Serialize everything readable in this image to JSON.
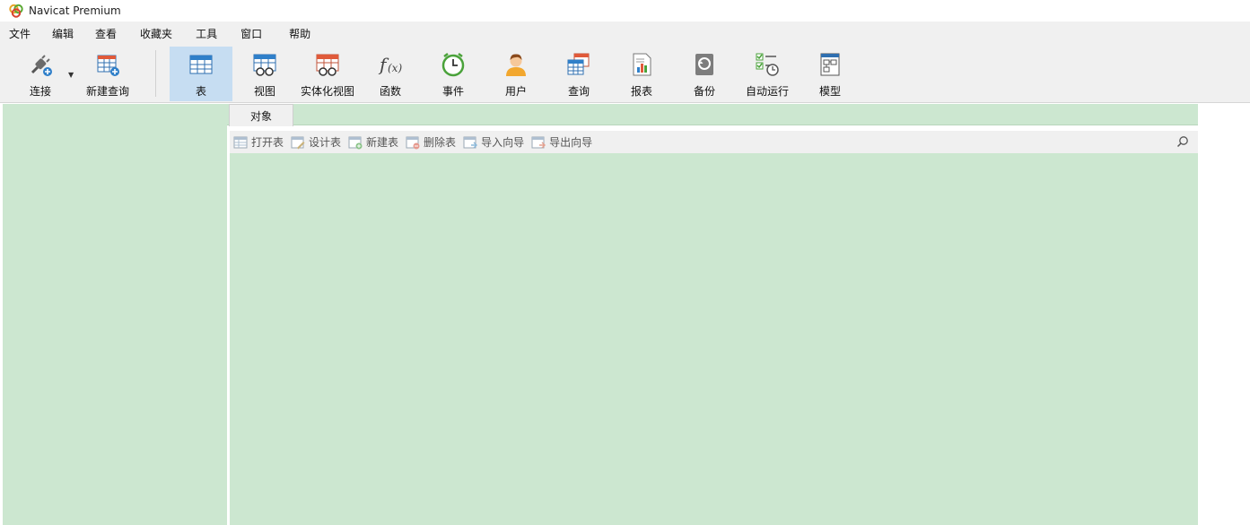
{
  "window": {
    "title": "Navicat Premium"
  },
  "menu": [
    "文件",
    "编辑",
    "查看",
    "收藏夹",
    "工具",
    "窗口",
    "帮助"
  ],
  "toolbar": {
    "connect": "连接",
    "new_query": "新建查询",
    "table": "表",
    "view": "视图",
    "materialized_view": "实体化视图",
    "function": "函数",
    "event": "事件",
    "user": "用户",
    "query": "查询",
    "report": "报表",
    "backup": "备份",
    "automation": "自动运行",
    "model": "模型"
  },
  "tabs": {
    "objects": "对象"
  },
  "object_toolbar": {
    "open_table": "打开表",
    "design_table": "设计表",
    "new_table": "新建表",
    "delete_table": "删除表",
    "import_wizard": "导入向导",
    "export_wizard": "导出向导"
  },
  "colors": {
    "panel_bg": "#cce7d0",
    "active_tool": "#c6ddf2",
    "chrome": "#f0f0f0"
  }
}
